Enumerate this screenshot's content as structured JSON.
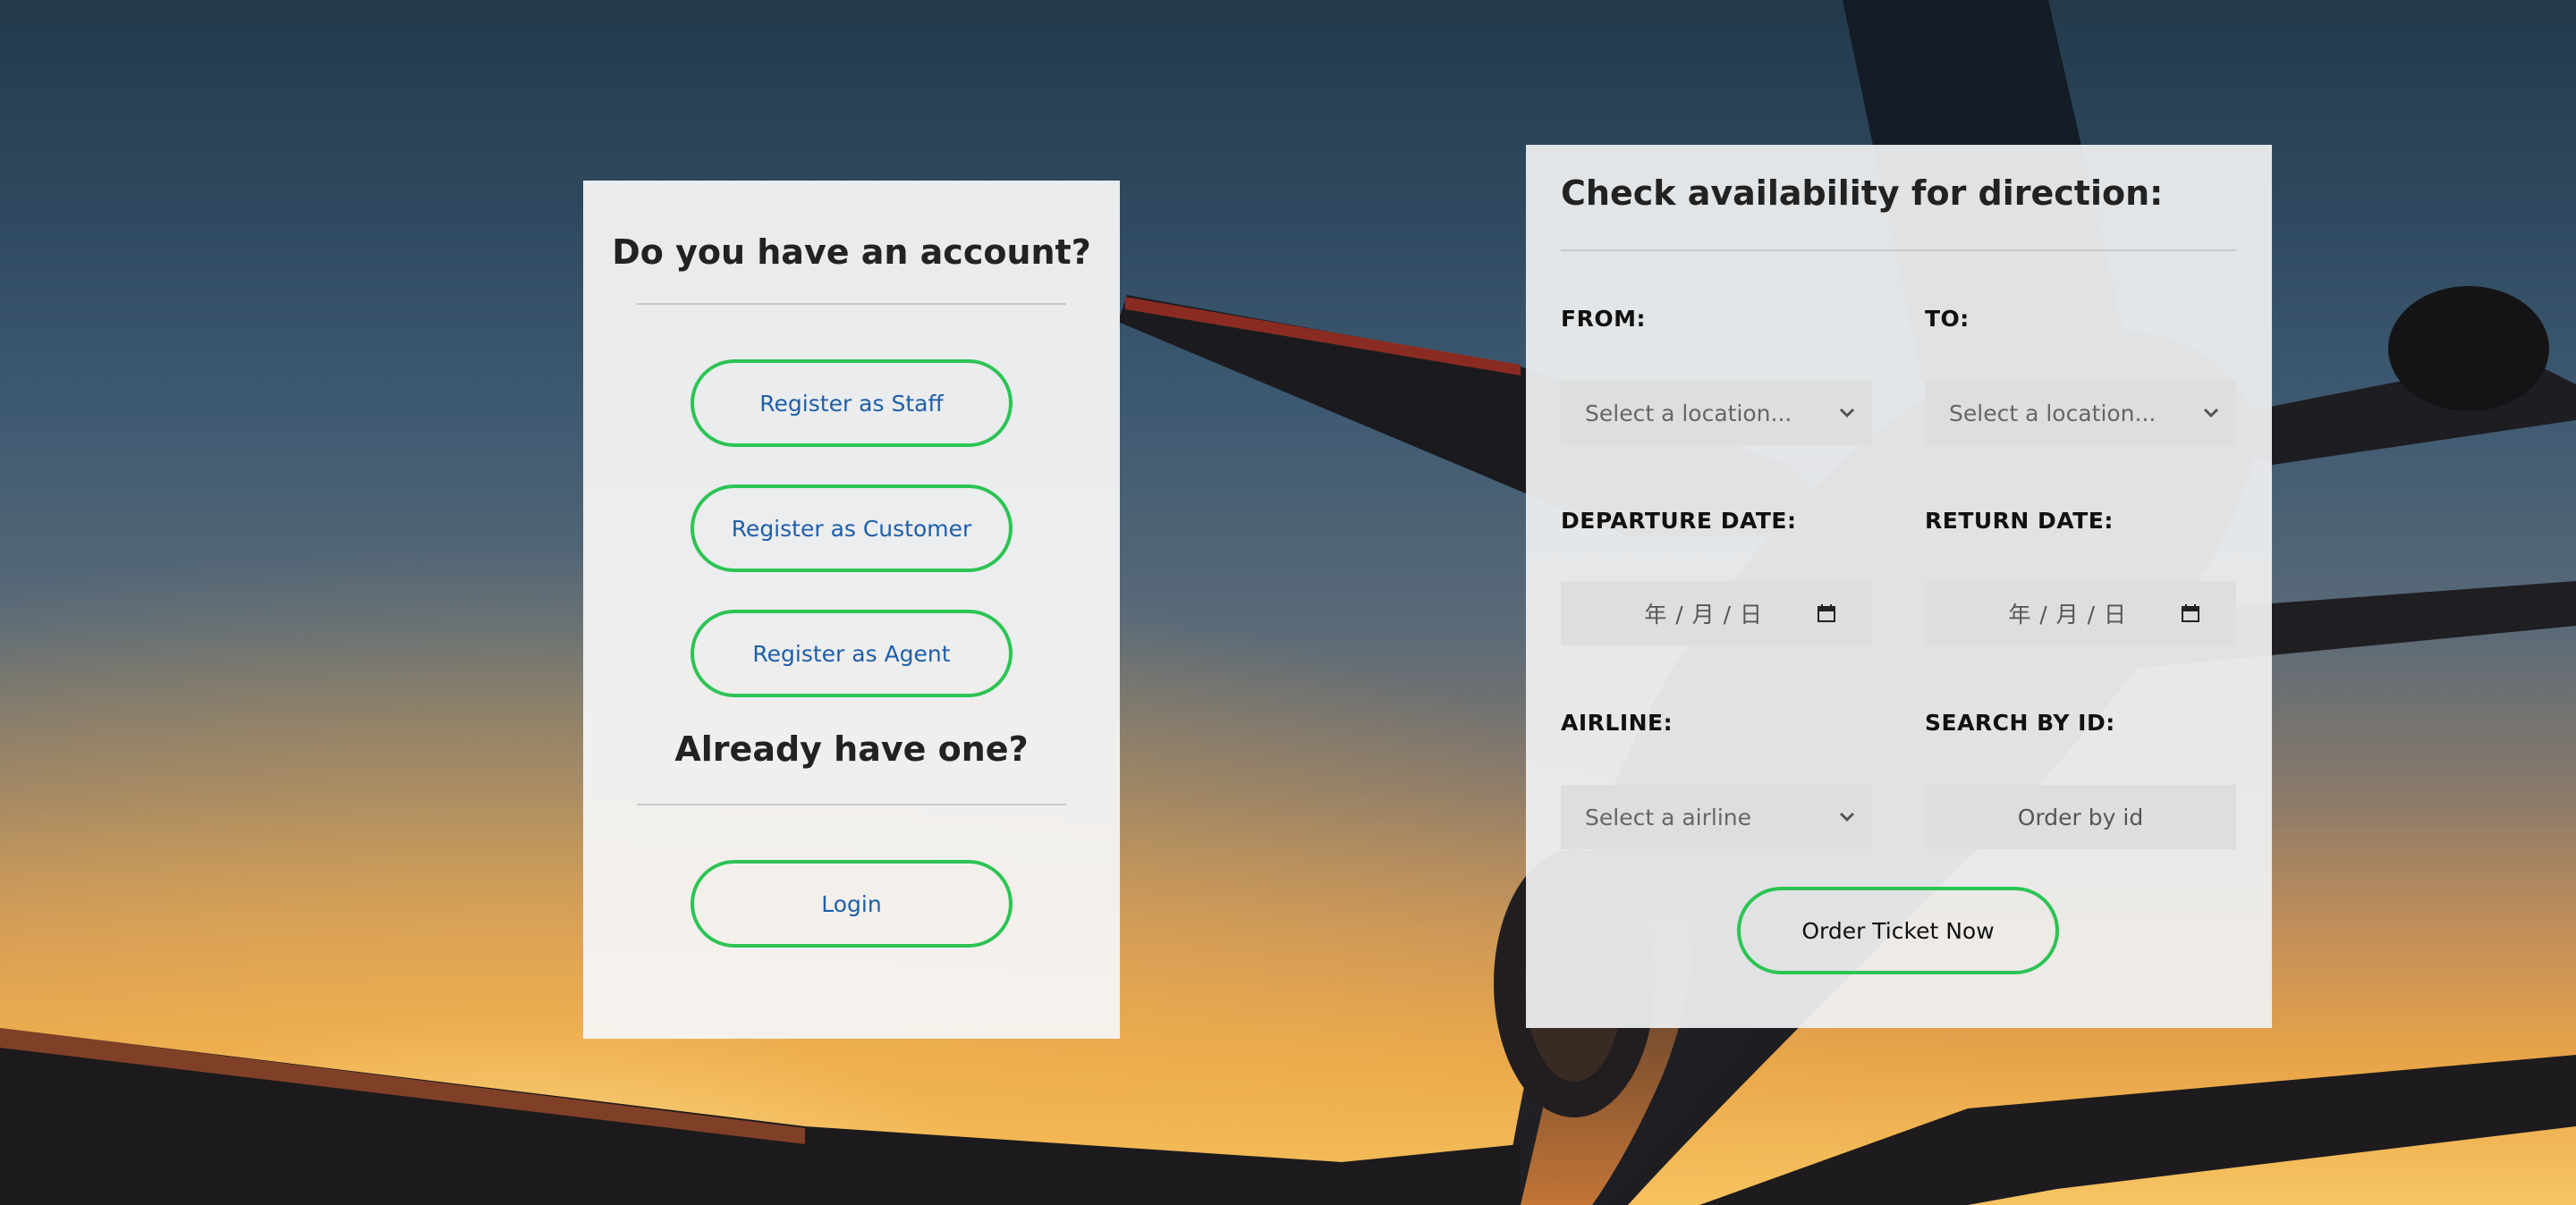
{
  "account": {
    "title": "Do you have an account?",
    "register_staff": "Register as Staff",
    "register_customer": "Register as Customer",
    "register_agent": "Register as Agent",
    "already_title": "Already have one?",
    "login": "Login"
  },
  "search": {
    "title": "Check availability for direction:",
    "from_label": "FROM:",
    "to_label": "TO:",
    "from_placeholder": "Select a location...",
    "to_placeholder": "Select a location...",
    "departure_label": "DEPARTURE DATE:",
    "return_label": "RETURN DATE:",
    "departure_value": "年 / 月 / 日",
    "return_value": "年 / 月 / 日",
    "airline_label": "AIRLINE:",
    "search_id_label": "SEARCH BY ID:",
    "airline_placeholder": "Select a airline",
    "search_id_placeholder": "Order by id",
    "order_button": "Order Ticket Now"
  },
  "colors": {
    "accent_green": "#2cc454",
    "link_blue": "#1f5fa8"
  },
  "icons": {
    "select_chevron": "chevron-down-icon",
    "date_picker": "calendar-icon"
  }
}
